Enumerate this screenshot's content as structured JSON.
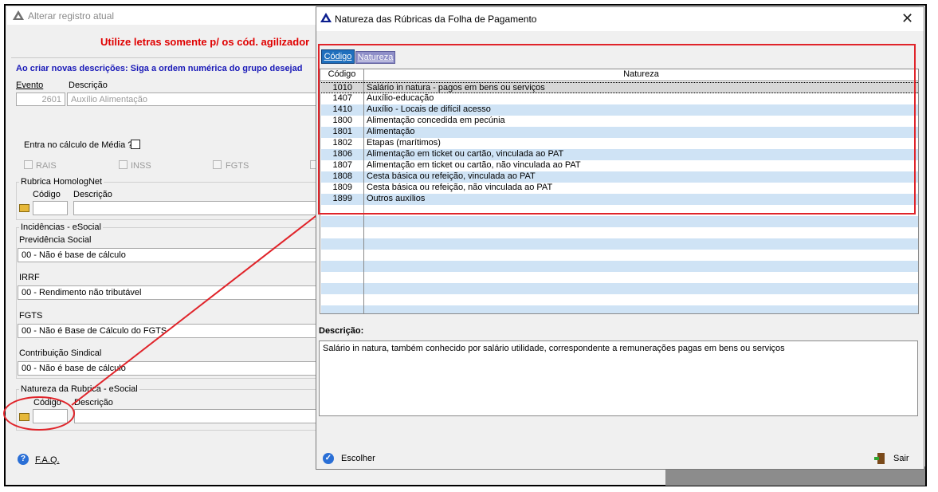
{
  "background_window": {
    "title": "Alterar registro atual",
    "warning": "Utilize letras somente p/ os cód. agilizador",
    "info": "Ao criar novas descrições: Siga a ordem numérica do grupo desejad",
    "evento_label": "Evento",
    "descricao_label": "Descrição",
    "evento_value": "2601",
    "descricao_value": "Auxílio Alimentação",
    "media_label": "Entra no cálculo de Média ?",
    "checks": [
      "RAIS",
      "INSS",
      "FGTS"
    ],
    "homolognet": {
      "title": "Rubrica HomologNet",
      "codigo_label": "Código",
      "descricao_label": "Descrição"
    },
    "incidencias": {
      "title": "Incidências - eSocial",
      "previdencia_label": "Previdência Social",
      "previdencia_value": "00 - Não é base de cálculo",
      "irrf_label": "IRRF",
      "irrf_value": "00 - Rendimento não tributável",
      "fgts_label": "FGTS",
      "fgts_value": "00 - Não é Base de Cálculo do FGTS",
      "sindical_label": "Contribuição Sindical",
      "sindical_value": "00 - Não é base de cálculo"
    },
    "natureza": {
      "title": "Natureza da Rubrica - eSocial",
      "codigo_label": "Código",
      "descricao_label": "Descrição"
    },
    "faq_label": "F.A.Q."
  },
  "dialog": {
    "title": "Natureza das Rúbricas da Folha de Pagamento",
    "close_symbol": "✕",
    "tabs": [
      {
        "label": "Código"
      },
      {
        "label": "Natureza"
      }
    ],
    "columns": {
      "codigo": "Código",
      "natureza": "Natureza"
    },
    "rows": [
      {
        "codigo": "1010",
        "natureza": "Salário in natura - pagos em bens ou serviços"
      },
      {
        "codigo": "1407",
        "natureza": "Auxílio-educação"
      },
      {
        "codigo": "1410",
        "natureza": "Auxílio - Locais de difícil acesso"
      },
      {
        "codigo": "1800",
        "natureza": "Alimentação concedida em pecúnia"
      },
      {
        "codigo": "1801",
        "natureza": "Alimentação"
      },
      {
        "codigo": "1802",
        "natureza": "Etapas (marítimos)"
      },
      {
        "codigo": "1806",
        "natureza": "Alimentação em ticket ou cartão, vinculada ao PAT"
      },
      {
        "codigo": "1807",
        "natureza": "Alimentação em ticket ou cartão, não vinculada ao PAT"
      },
      {
        "codigo": "1808",
        "natureza": "Cesta básica ou refeição, vinculada ao PAT"
      },
      {
        "codigo": "1809",
        "natureza": "Cesta básica ou refeição, não vinculada ao PAT"
      },
      {
        "codigo": "1899",
        "natureza": "Outros auxílios"
      }
    ],
    "descricao_label": "Descrição:",
    "descricao_text": "Salário in natura, também conhecido por salário utilidade, correspondente a remunerações pagas em bens ou serviços",
    "escolher_label": "Escolher",
    "sair_label": "Sair"
  },
  "colors": {
    "highlight_red": "#e0242a",
    "row_blue": "#cfe3f5",
    "tab_active": "#1e6fbd",
    "warning_red": "#e00000",
    "info_blue": "#1a1ab8"
  },
  "icons": [
    "warning-triangle-icon",
    "folder-open-icon",
    "help-icon",
    "exit-door-icon",
    "close-icon"
  ]
}
